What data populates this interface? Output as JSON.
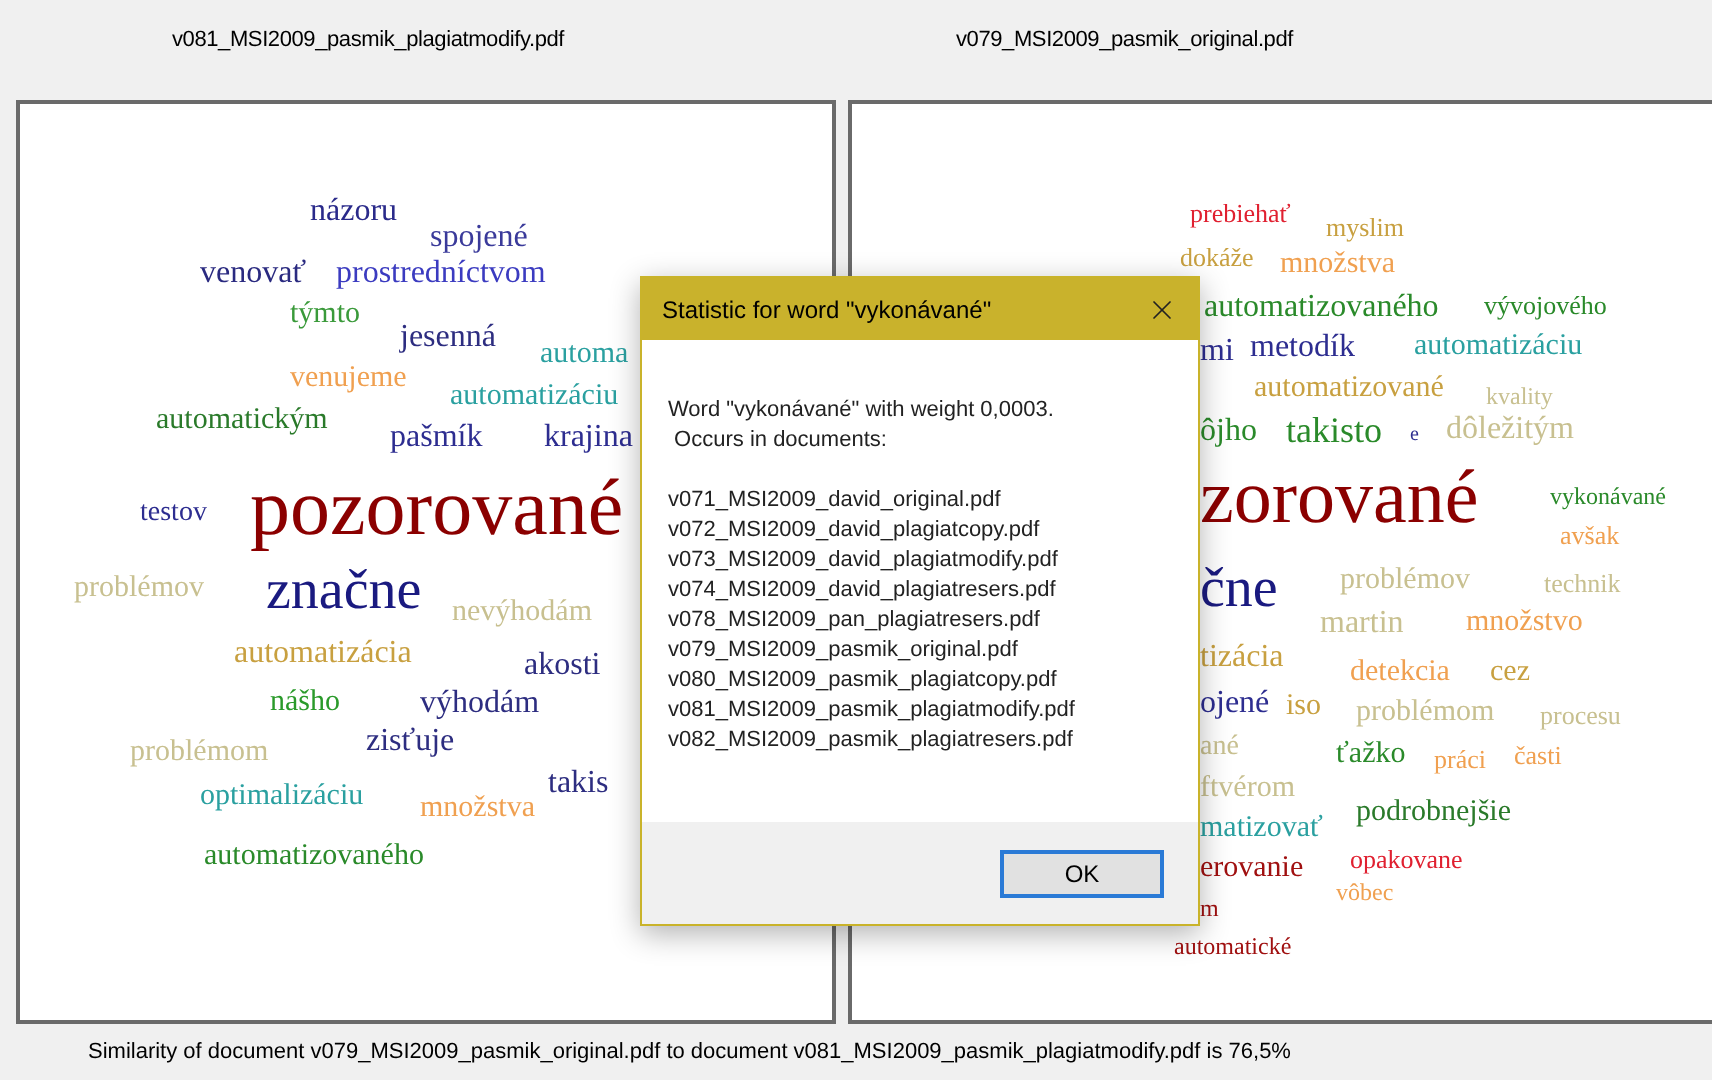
{
  "panels": [
    {
      "title": "v081_MSI2009_pasmik_plagiatmodify.pdf",
      "words": [
        {
          "text": "názoru",
          "color": "#2a2a8a"
        },
        {
          "text": "spojené",
          "color": "#3a3a9a"
        },
        {
          "text": "venovať",
          "color": "#2a2a80"
        },
        {
          "text": "prostredníctvom",
          "color": "#3b3bc0"
        },
        {
          "text": "týmto",
          "color": "#3a9a3a"
        },
        {
          "text": "jesenná",
          "color": "#2d2d80"
        },
        {
          "text": "automa",
          "color": "#2aa0a0"
        },
        {
          "text": "venujeme",
          "color": "#f0a050"
        },
        {
          "text": "automatizáciu",
          "color": "#2aa0a0"
        },
        {
          "text": "automatickým",
          "color": "#2a7a2a"
        },
        {
          "text": "pašmík",
          "color": "#2d2d90"
        },
        {
          "text": "krajina",
          "color": "#2d2d90"
        },
        {
          "text": "testov",
          "color": "#2d2d90"
        },
        {
          "text": "pozorované",
          "color": "#8b0000"
        },
        {
          "text": "problémov",
          "color": "#c8c090"
        },
        {
          "text": "značne",
          "color": "#1a1a80"
        },
        {
          "text": "nevýhodám",
          "color": "#c8c090"
        },
        {
          "text": "automatizácia",
          "color": "#c8a040"
        },
        {
          "text": "akosti",
          "color": "#2d2d80"
        },
        {
          "text": "nášho",
          "color": "#2a9a2a"
        },
        {
          "text": "výhodám",
          "color": "#2d2d80"
        },
        {
          "text": "zisťuje",
          "color": "#2d2d80"
        },
        {
          "text": "problémom",
          "color": "#c8c090"
        },
        {
          "text": "takis",
          "color": "#2d2d80"
        },
        {
          "text": "optimalizáciu",
          "color": "#2aa0a0"
        },
        {
          "text": "množstva",
          "color": "#f0a050"
        },
        {
          "text": "automatizovaného",
          "color": "#2a8a2a"
        }
      ]
    },
    {
      "title": "v079_MSI2009_pasmik_original.pdf",
      "words": [
        {
          "text": "prebiehať",
          "color": "#e02030"
        },
        {
          "text": "myslim",
          "color": "#c8a040"
        },
        {
          "text": "dokáže",
          "color": "#c8a040"
        },
        {
          "text": "množstva",
          "color": "#f0a050"
        },
        {
          "text": "automatizovaného",
          "color": "#2a8a2a"
        },
        {
          "text": "vývojového",
          "color": "#2a8a2a"
        },
        {
          "text": "mi",
          "color": "#2d2d90"
        },
        {
          "text": "metodík",
          "color": "#2d2d90"
        },
        {
          "text": "automatizáciu",
          "color": "#2aa0a0"
        },
        {
          "text": "automatizované",
          "color": "#c8a040"
        },
        {
          "text": "kvality",
          "color": "#c8c090"
        },
        {
          "text": "ôjho",
          "color": "#2a8a2a"
        },
        {
          "text": "takisto",
          "color": "#2a8a2a"
        },
        {
          "text": "e",
          "color": "#2d2d90"
        },
        {
          "text": "dôležitým",
          "color": "#c8c090"
        },
        {
          "text": "zorované",
          "color": "#8b0000"
        },
        {
          "text": "vykonávané",
          "color": "#2a8a2a"
        },
        {
          "text": "avšak",
          "color": "#f0a050"
        },
        {
          "text": "čne",
          "color": "#1a1a80"
        },
        {
          "text": "problémov",
          "color": "#c8c090"
        },
        {
          "text": "technik",
          "color": "#c8c090"
        },
        {
          "text": "martin",
          "color": "#c8c090"
        },
        {
          "text": "množstvo",
          "color": "#f0a050"
        },
        {
          "text": "tizácia",
          "color": "#c8a040"
        },
        {
          "text": "detekcia",
          "color": "#f0a050"
        },
        {
          "text": "cez",
          "color": "#c8a040"
        },
        {
          "text": "ojené",
          "color": "#2d2d90"
        },
        {
          "text": "iso",
          "color": "#c8a040"
        },
        {
          "text": "problémom",
          "color": "#c8c090"
        },
        {
          "text": "procesu",
          "color": "#c8c090"
        },
        {
          "text": "ané",
          "color": "#c8c090"
        },
        {
          "text": "ťažko",
          "color": "#2a8a2a"
        },
        {
          "text": "práci",
          "color": "#f0a050"
        },
        {
          "text": "časti",
          "color": "#f0a050"
        },
        {
          "text": "ftvérom",
          "color": "#c8c090"
        },
        {
          "text": "matizovať",
          "color": "#2aa0a0"
        },
        {
          "text": "podrobnejšie",
          "color": "#2a7a2a"
        },
        {
          "text": "erovanie",
          "color": "#a01010"
        },
        {
          "text": "opakovane",
          "color": "#e02030"
        },
        {
          "text": "vôbec",
          "color": "#f0a050"
        },
        {
          "text": "m",
          "color": "#a01010"
        },
        {
          "text": "automatické",
          "color": "#a01010"
        }
      ]
    }
  ],
  "dialog": {
    "title": "Statistic for word \"vykonávané\"",
    "message": "Word \"vykonávané\" with weight 0,0003.",
    "subtitle": " Occurs in documents:",
    "documents": [
      "v071_MSI2009_david_original.pdf",
      "v072_MSI2009_david_plagiatcopy.pdf",
      "v073_MSI2009_david_plagiatmodify.pdf",
      "v074_MSI2009_david_plagiatresers.pdf",
      "v078_MSI2009_pan_plagiatresers.pdf",
      "v079_MSI2009_pasmik_original.pdf",
      "v080_MSI2009_pasmik_plagiatcopy.pdf",
      "v081_MSI2009_pasmik_plagiatmodify.pdf",
      "v082_MSI2009_pasmik_plagiatresers.pdf"
    ],
    "buttons": [
      "OK"
    ]
  },
  "status_bar": "Similarity of document v079_MSI2009_pasmik_original.pdf to document v081_MSI2009_pasmik_plagiatmodify.pdf is 76,5%"
}
